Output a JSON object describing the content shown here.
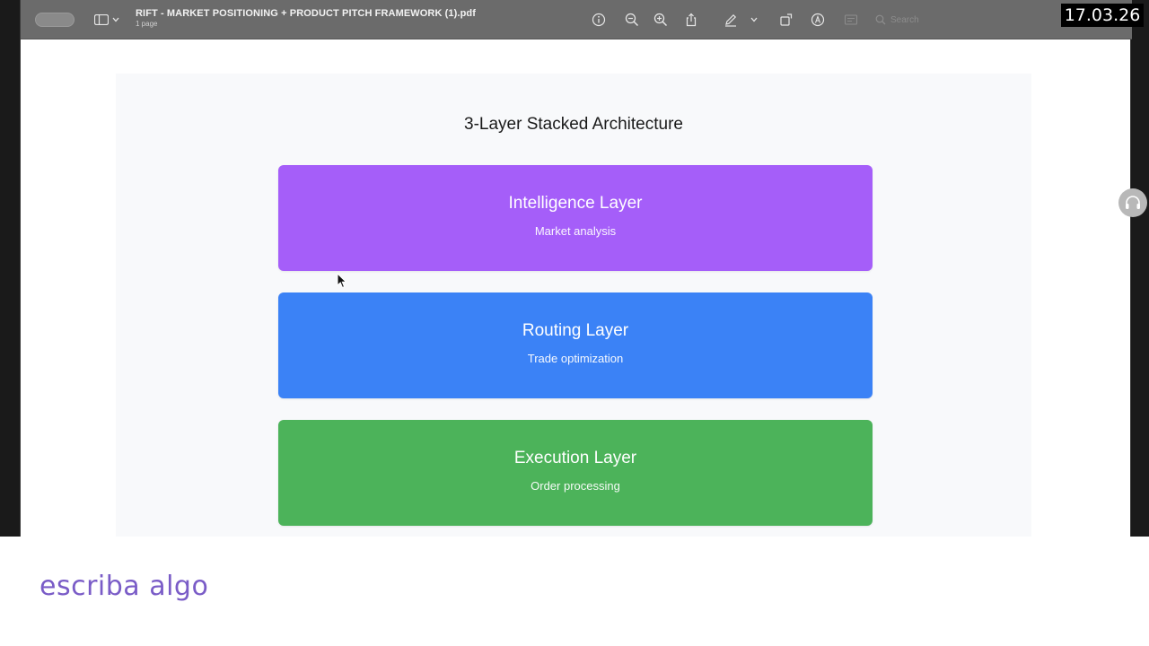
{
  "viewer": {
    "document_title": "RIFT - MARKET POSITIONING + PRODUCT PITCH FRAMEWORK (1).pdf",
    "page_count": "1 page",
    "search_placeholder": "Search",
    "toolbar_icons": [
      "info-icon",
      "zoom-out-icon",
      "zoom-in-icon",
      "share-icon",
      "markup-pen-icon",
      "chevron-down-icon",
      "rotate-icon",
      "annotate-icon",
      "form-icon",
      "search-icon"
    ]
  },
  "overlay": {
    "date_stamp": "17.03.26"
  },
  "diagram": {
    "title": "3-Layer Stacked Architecture",
    "layers": [
      {
        "name": "Intelligence Layer",
        "description": "Market analysis",
        "color": "#a55ef9"
      },
      {
        "name": "Routing Layer",
        "description": "Trade optimization",
        "color": "#3b82f6"
      },
      {
        "name": "Execution Layer",
        "description": "Order processing",
        "color": "#4cb35a"
      }
    ]
  },
  "caption": {
    "text": "escriba algo",
    "color": "#7a5cc7"
  }
}
